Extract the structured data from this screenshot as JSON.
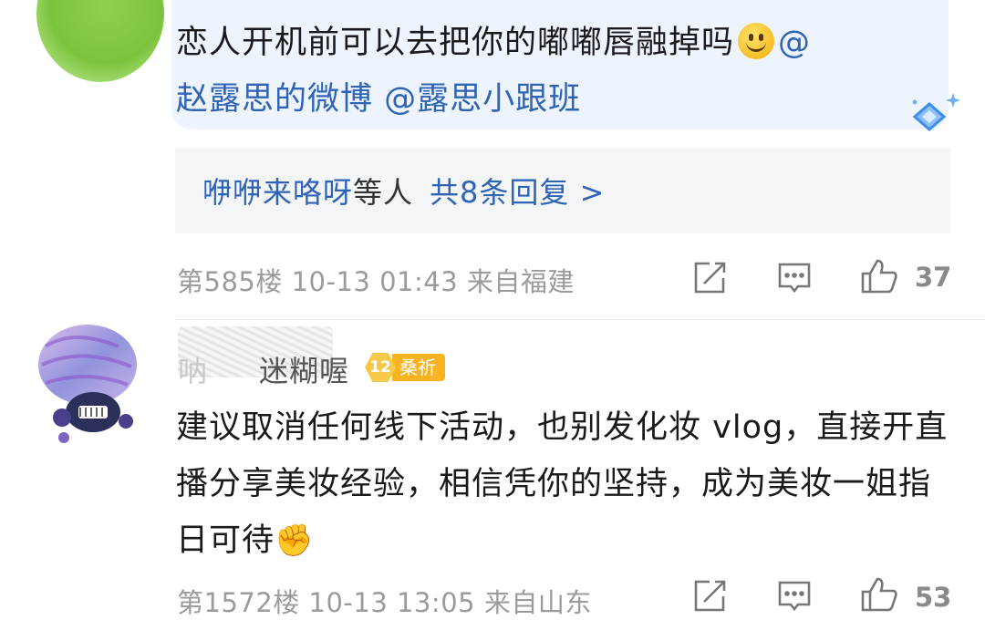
{
  "comment1": {
    "text": "恋人开机前可以去把你的嘟嘟唇融掉吗",
    "mention_at": "@",
    "mention1": "赵露思的微博",
    "mention2": "@露思小跟班",
    "replies_users": "咿咿来咯呀",
    "replies_suffix": "等人",
    "replies_count": "共8条回复 >",
    "floor": "第585楼",
    "date": "10-13",
    "time": "01:43",
    "location": "来自福建",
    "likes": "37"
  },
  "comment2": {
    "username_visible": "迷糊喔",
    "username_prefix": "呐",
    "badge_level": "12",
    "badge_name": "桑祈",
    "text": "建议取消任何线下活动，也别发化妆 vlog，直接开直播分享美妆经验，相信凭你的坚持，成为美妆一姐指日可待",
    "emoji": "✊",
    "floor": "第1572楼",
    "date": "10-13",
    "time": "13:05",
    "location": "来自山东",
    "likes": "53"
  },
  "icons": [
    "smile-emoji",
    "sparkle-icon",
    "share-icon",
    "comment-icon",
    "like-icon"
  ],
  "colors": {
    "link": "#2e63b5",
    "meta": "#9b9b9b",
    "highlight_bg": "#eef4fd",
    "reply_bg": "#f4f5f7",
    "badge": "#f8b322"
  }
}
